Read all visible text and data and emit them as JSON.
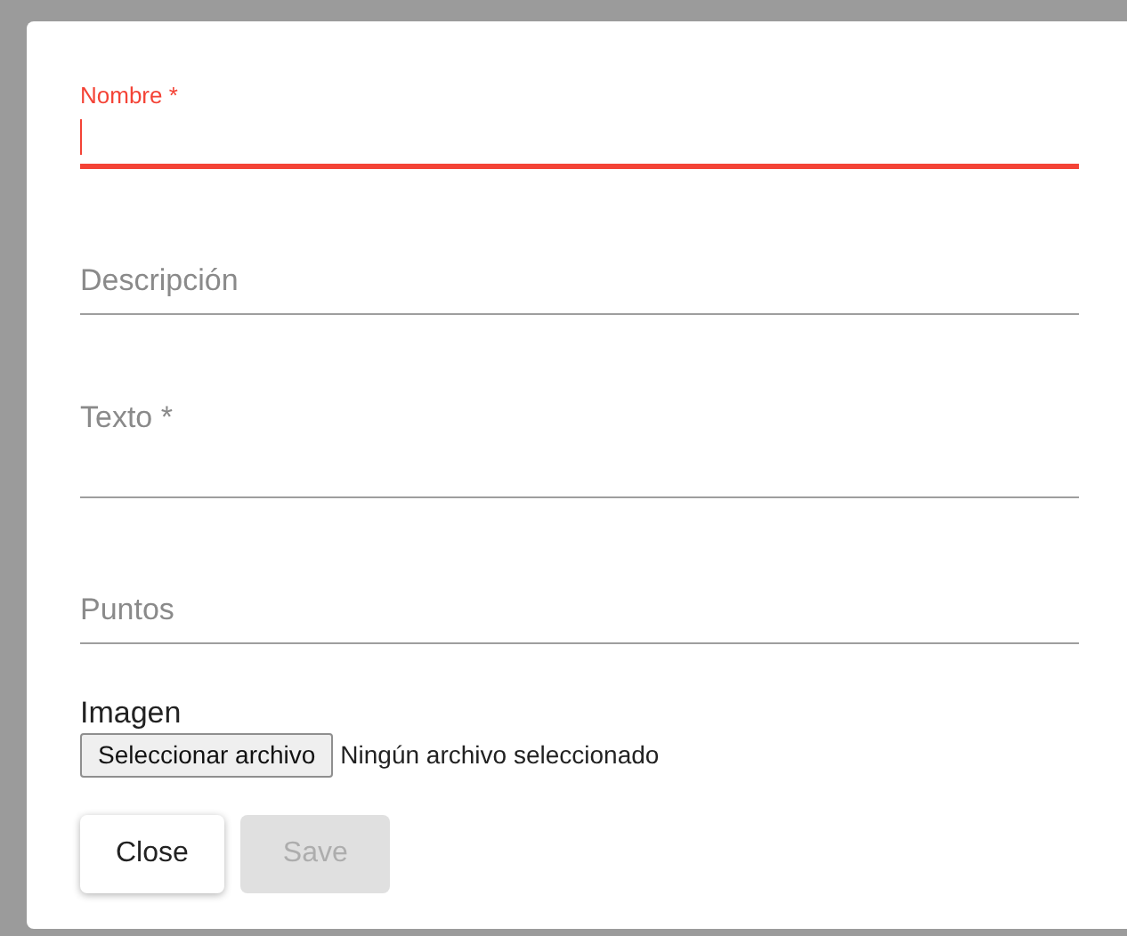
{
  "fields": [
    {
      "label": "Nombre *",
      "focused": true,
      "kind": "line"
    },
    {
      "label": "Descripción",
      "focused": false,
      "kind": "line"
    },
    {
      "label": "Texto *",
      "focused": false,
      "kind": "multiline"
    },
    {
      "label": "Puntos",
      "focused": false,
      "kind": "line"
    }
  ],
  "image": {
    "label": "Imagen",
    "button": "Seleccionar archivo",
    "status": "Ningún archivo seleccionado"
  },
  "buttons": [
    {
      "label": "Close",
      "disabled": false
    },
    {
      "label": "Save",
      "disabled": true
    }
  ]
}
